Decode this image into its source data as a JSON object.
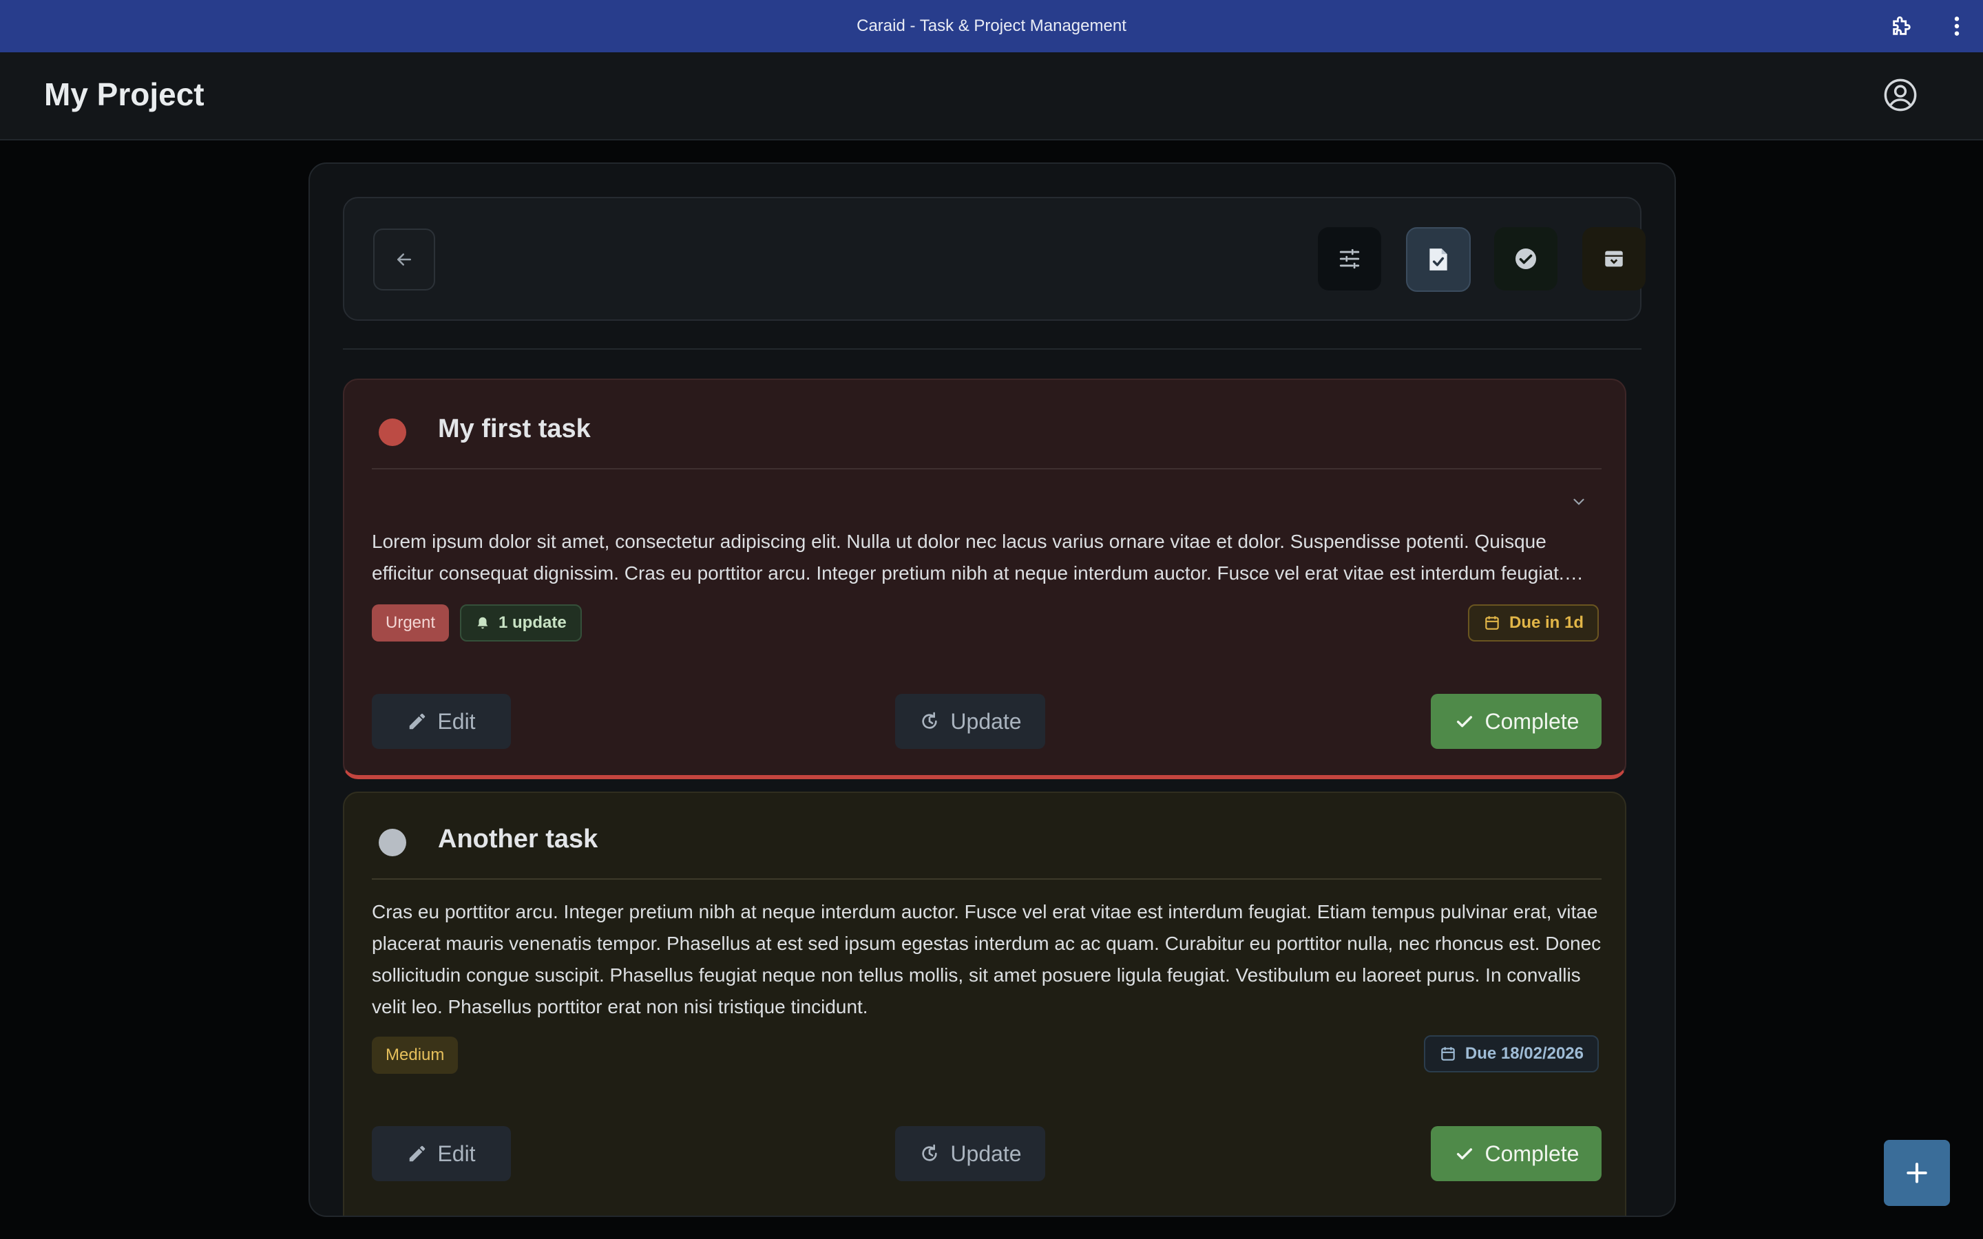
{
  "window": {
    "title": "Caraid - Task & Project Management"
  },
  "header": {
    "project_title": "My Project"
  },
  "toolbar": {
    "back_icon": "arrow-left-icon",
    "views": [
      {
        "icon": "sliders-icon",
        "name": "filter"
      },
      {
        "icon": "document-check-icon",
        "name": "active-tasks",
        "selected": true
      },
      {
        "icon": "check-circle-icon",
        "name": "completed"
      },
      {
        "icon": "archive-icon",
        "name": "archive"
      }
    ]
  },
  "tasks": [
    {
      "title": "My first task",
      "status_color": "#bc4b44",
      "description": "Lorem ipsum dolor sit amet, consectetur adipiscing elit. Nulla ut dolor nec lacus varius ornare vitae et dolor. Suspendisse potenti. Quisque efficitur consequat dignissim. Cras eu porttitor arcu. Integer pretium nibh at neque interdum auctor. Fusce vel erat vitae est interdum feugiat. Etiam tempus pulvinar erat, vitae placerat mauris venenatis tempor.",
      "priority": "Urgent",
      "updates": "1 update",
      "due": "Due in 1d",
      "edit_label": "Edit",
      "update_label": "Update",
      "complete_label": "Complete"
    },
    {
      "title": "Another task",
      "status_color": "#b7bdc4",
      "description": "Cras eu porttitor arcu. Integer pretium nibh at neque interdum auctor. Fusce vel erat vitae est interdum feugiat. Etiam tempus pulvinar erat, vitae placerat mauris venenatis tempor. Phasellus at est sed ipsum egestas interdum ac ac quam. Curabitur eu porttitor nulla, nec rhoncus est. Donec sollicitudin congue suscipit. Phasellus feugiat neque non tellus mollis, sit amet posuere ligula feugiat. Vestibulum eu laoreet purus. In convallis velit leo. Phasellus porttitor erat non nisi tristique tincidunt.",
      "priority": "Medium",
      "due": "Due 18/02/2026",
      "edit_label": "Edit",
      "update_label": "Update",
      "complete_label": "Complete"
    }
  ],
  "fab": {
    "icon": "plus-icon"
  },
  "colors": {
    "titlebar": "#283d8c",
    "complete": "#4f8a49",
    "urgent": "#c4453f",
    "fab": "#3a6d99"
  }
}
